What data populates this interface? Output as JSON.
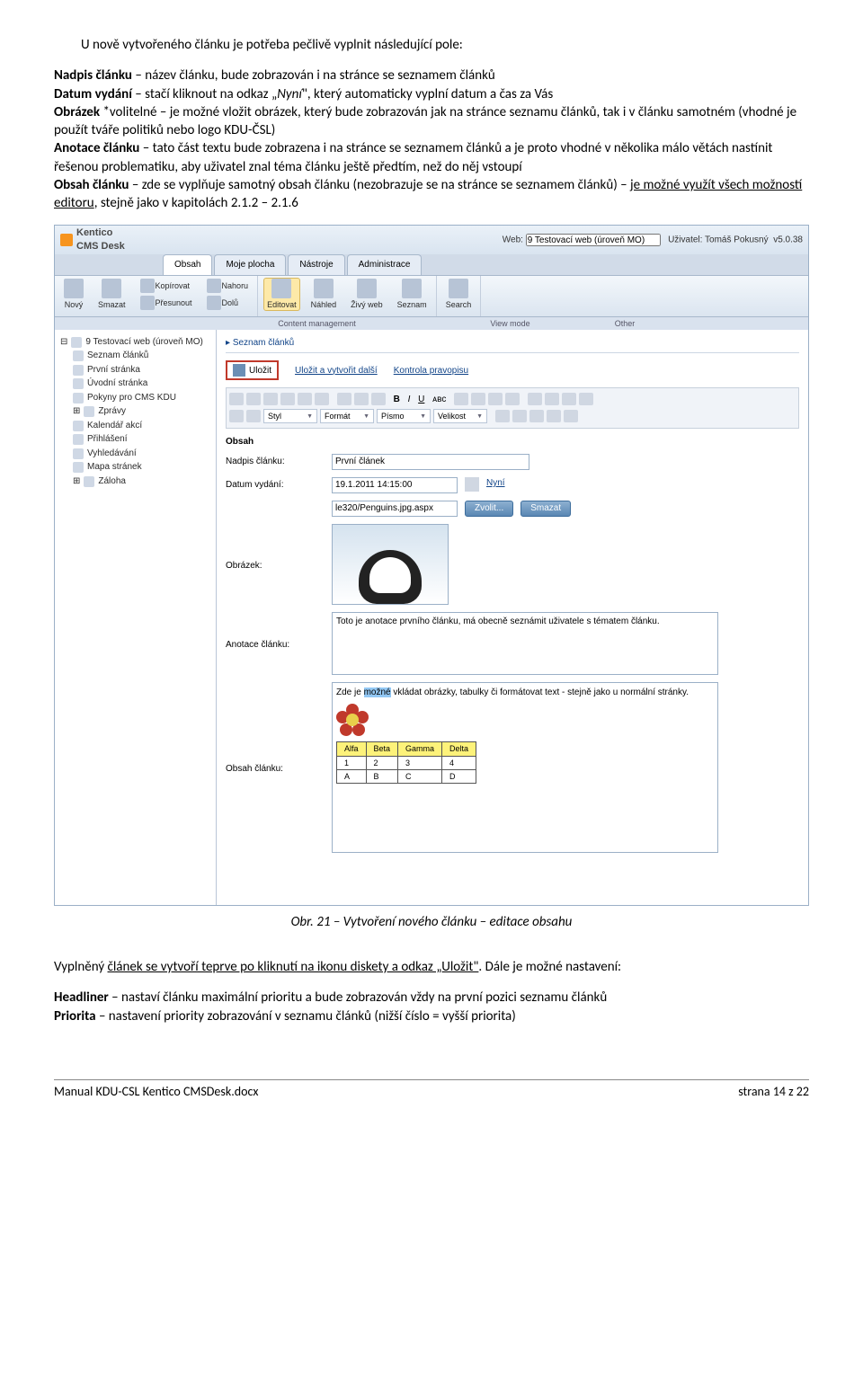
{
  "intro": "U nově vytvořeného článku je potřeba pečlivě vyplnit následující pole:",
  "defs": {
    "nadpis": {
      "term": "Nadpis článku",
      "text": " – název článku, bude zobrazován i na stránce se seznamem článků"
    },
    "datum": {
      "term": "Datum vydání",
      "text": " – stačí kliknout na odkaz „",
      "em": "Nyní",
      "text2": "\", který automaticky vyplní datum a čas za Vás"
    },
    "obrazek": {
      "term": "Obrázek",
      "text": " *volitelné – je možné vložit obrázek, který bude zobrazován jak na stránce seznamu článků, tak i v článku samotném (vhodné je použít tváře politiků nebo logo KDU-ČSL)"
    },
    "anotace": {
      "term": "Anotace článku",
      "text": " – tato část textu bude zobrazena i na stránce se seznamem článků a je proto vhodné v několika málo větách nastínit řešenou problematiku, aby uživatel znal téma článku ještě předtím, než do něj vstoupí"
    },
    "obsah": {
      "term": "Obsah článku",
      "text": " – zde se vyplňuje samotný obsah článku (nezobrazuje se na stránce se seznamem článků) – ",
      "u": "je možné využít všech možností editoru",
      "text2": ", stejně jako v kapitolách 2.1.2 – 2.1.6"
    }
  },
  "ss": {
    "logo": {
      "a": "Kentico",
      "b": "CMS Desk"
    },
    "hdr": {
      "web_label": "Web:",
      "web_value": "9 Testovací web (úroveň MO)",
      "user_label": "Uživatel:",
      "user": "Tomáš Pokusný",
      "ver": "v5.0.38"
    },
    "tabs": [
      "Obsah",
      "Moje plocha",
      "Nástroje",
      "Administrace"
    ],
    "tb": {
      "group1": [
        {
          "label": "Nový"
        },
        {
          "label": "Smazat"
        }
      ],
      "group1b": [
        {
          "label": "Kopírovat"
        },
        {
          "label": "Nahoru"
        },
        {
          "label": "Přesunout"
        },
        {
          "label": "Dolů"
        }
      ],
      "group2": [
        {
          "label": "Editovat"
        },
        {
          "label": "Náhled"
        },
        {
          "label": "Živý web"
        },
        {
          "label": "Seznam"
        }
      ],
      "group3": [
        {
          "label": "Search"
        }
      ],
      "labels": [
        "Content management",
        "View mode",
        "Other"
      ]
    },
    "tree": [
      "9 Testovací web (úroveň MO)",
      "Seznam článků",
      "První stránka",
      "Úvodní stránka",
      "Pokyny pro CMS KDU",
      "Zprávy",
      "Kalendář akcí",
      "Přihlášení",
      "Vyhledávání",
      "Mapa stránek",
      "Záloha"
    ],
    "crumb": "Seznam článků",
    "save": {
      "btn": "Uložit",
      "link1": "Uložit a vytvořit další",
      "link2": "Kontrola pravopisu"
    },
    "ed_selects": [
      "Styl",
      "Formát",
      "Písmo",
      "Velikost"
    ],
    "form": {
      "section": "Obsah",
      "nadpis": {
        "label": "Nadpis článku:",
        "value": "První článek"
      },
      "datum": {
        "label": "Datum vydání:",
        "value": "19.1.2011 14:15:00",
        "link": "Nyní"
      },
      "imgpath": "le320/Penguins.jpg.aspx",
      "zvolit": "Zvolit...",
      "smazat": "Smazat",
      "obrazek_label": "Obrázek:",
      "anotace_label": "Anotace článku:",
      "anotace_text": "Toto je anotace prvního článku, má obecně seznámit uživatele s tématem článku.",
      "obsah_label": "Obsah článku:",
      "obsah_text1": "Zde je ",
      "obsah_hl": "možné",
      "obsah_text2": " vkládat obrázky, tabulky či formátovat text - stejně jako u normální stránky.",
      "tbl": {
        "head": [
          "Alfa",
          "Beta",
          "Gamma",
          "Delta"
        ],
        "r1": [
          "1",
          "2",
          "3",
          "4"
        ],
        "r2": [
          "A",
          "B",
          "C",
          "D"
        ]
      }
    }
  },
  "caption": "Obr. 21 – Vytvoření nového článku – editace obsahu",
  "para2a": "Vyplněný ",
  "para2u": "článek se vytvoří teprve po kliknutí na ikonu diskety a odkaz „Uložit\"",
  "para2b": ". Dále je možné nastavení:",
  "headliner": {
    "term": "Headliner",
    "text": " – nastaví článku maximální prioritu a bude zobrazován vždy na první pozici seznamu článků"
  },
  "priorita": {
    "term": "Priorita",
    "text": " – nastavení priority zobrazování v seznamu článků (nižší číslo = vyšší priorita)"
  },
  "footer": {
    "left": "Manual KDU-CSL Kentico CMSDesk.docx",
    "right": "strana 14 z 22"
  }
}
